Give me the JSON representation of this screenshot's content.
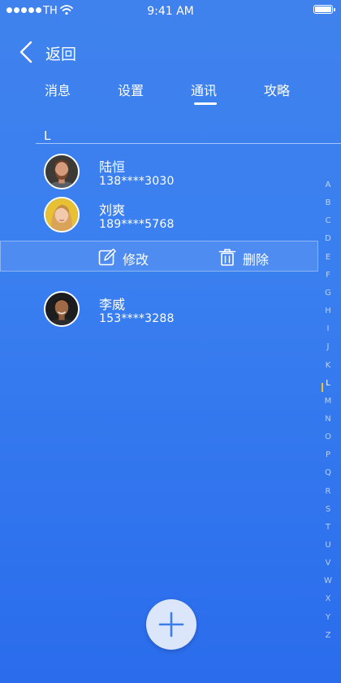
{
  "status_bar": {
    "carrier": "TH",
    "time": "9:41 AM"
  },
  "nav": {
    "back_label": "返回"
  },
  "tabs": [
    {
      "label": "消息",
      "active": false
    },
    {
      "label": "设置",
      "active": false
    },
    {
      "label": "通讯",
      "active": true
    },
    {
      "label": "攻略",
      "active": false
    }
  ],
  "section": {
    "letter": "L"
  },
  "contacts": [
    {
      "name": "陆恒",
      "phone": "138****3030",
      "avatar": "avatar-man-beard"
    },
    {
      "name": "刘爽",
      "phone": "189****5768",
      "avatar": "avatar-woman-blonde"
    },
    {
      "name": "李威",
      "phone": "153****3288",
      "avatar": "avatar-man-dark"
    }
  ],
  "actions": {
    "edit_label": "修改",
    "edit_icon": "edit-icon",
    "delete_label": "删除",
    "delete_icon": "trash-icon"
  },
  "index": {
    "letters": [
      "A",
      "B",
      "C",
      "D",
      "E",
      "F",
      "G",
      "H",
      "I",
      "J",
      "K",
      "L",
      "M",
      "N",
      "O",
      "P",
      "Q",
      "R",
      "S",
      "T",
      "U",
      "V",
      "W",
      "X",
      "Y",
      "Z"
    ],
    "active": "L"
  },
  "fab_icon": "plus-icon",
  "colors": {
    "background_top": "#3f82ee",
    "background_bottom": "#2a6cec",
    "index_marker": "#f4c21a",
    "fab_background": "#dbe6fb",
    "fab_plus": "#3b7ee8"
  }
}
